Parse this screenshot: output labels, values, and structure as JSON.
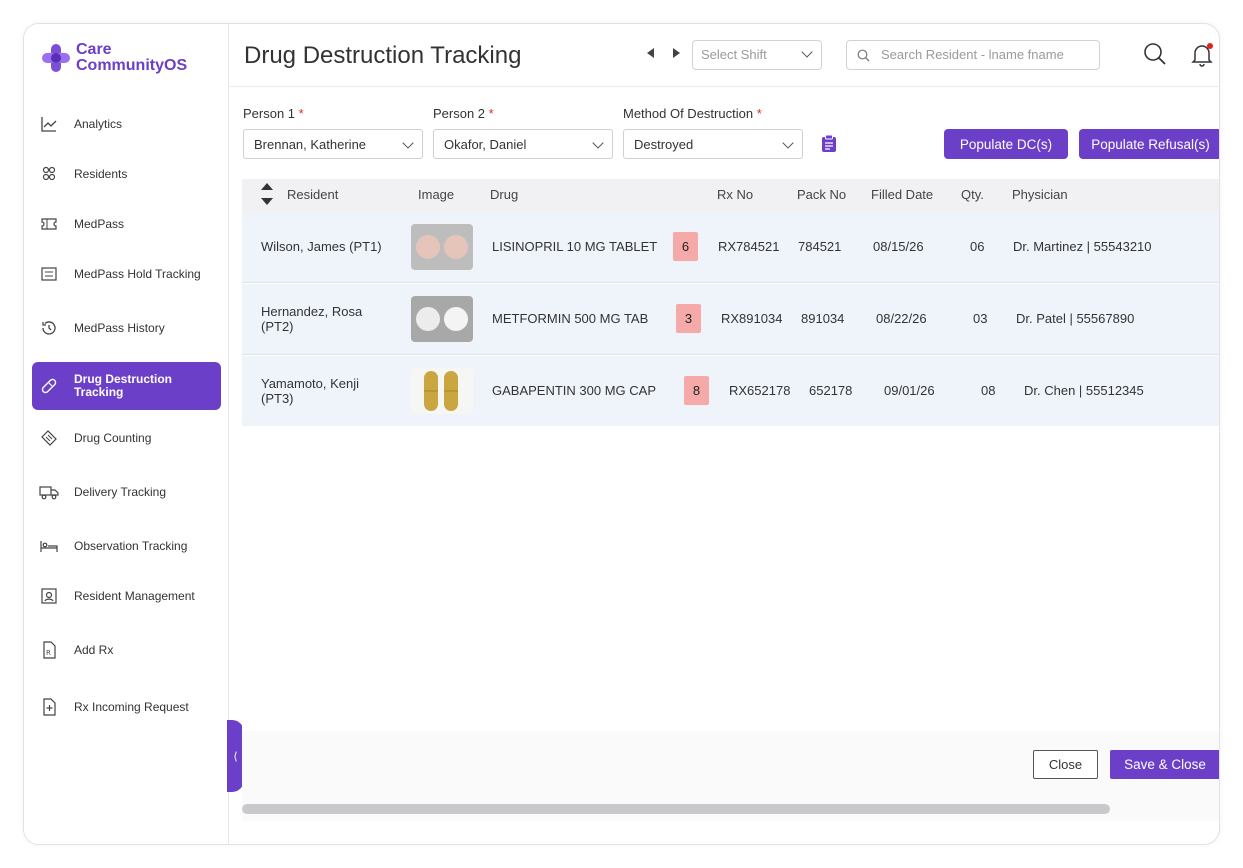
{
  "app": {
    "logo_line1": "Care",
    "logo_line2": "CommunityOS",
    "brand_color": "#6b3fc8"
  },
  "sidebar": {
    "items": [
      {
        "label": "Analytics",
        "icon": "chart-line-icon"
      },
      {
        "label": "Residents",
        "icon": "people-icon"
      },
      {
        "label": "MedPass",
        "icon": "ticket-icon"
      },
      {
        "label": "MedPass Hold Tracking",
        "icon": "hold-list-icon"
      },
      {
        "label": "MedPass History",
        "icon": "history-icon"
      },
      {
        "label": "Drug Destruction Tracking",
        "icon": "pill-icon",
        "active": true
      },
      {
        "label": "Drug Counting",
        "icon": "tag-icon"
      },
      {
        "label": "Delivery Tracking",
        "icon": "truck-icon"
      },
      {
        "label": "Observation Tracking",
        "icon": "bed-icon"
      },
      {
        "label": "Resident Management",
        "icon": "id-card-icon"
      },
      {
        "label": "Add Rx",
        "icon": "rx-file-icon"
      },
      {
        "label": "Rx Incoming Request",
        "icon": "file-plus-icon"
      }
    ],
    "collapse_glyph": "⟨"
  },
  "header": {
    "title": "Drug Destruction Tracking",
    "shift_placeholder": "Select Shift",
    "search_placeholder": "Search Resident - lname fname"
  },
  "filters": {
    "person1_label": "Person 1",
    "person1_value": "Brennan, Katherine",
    "person2_label": "Person 2",
    "person2_value": "Okafor, Daniel",
    "method_label": "Method Of Destruction",
    "method_value": "Destroyed",
    "required_mark": "*",
    "populate_dc_label": "Populate DC(s)",
    "populate_refusal_label": "Populate Refusal(s)"
  },
  "table": {
    "columns": [
      "Resident",
      "Image",
      "Drug",
      "Rx No",
      "Pack No",
      "Filled Date",
      "Qty.",
      "Physician"
    ],
    "rows": [
      {
        "resident": "Wilson, James (PT1)",
        "drug": "LISINOPRIL 10 MG TABLET",
        "badge": "6",
        "rx_no": "RX784521",
        "pack_no": "784521",
        "filled_date": "08/15/26",
        "qty": "06",
        "physician": "Dr. Martinez | 55543210",
        "pill": "pink-round-tablets"
      },
      {
        "resident": "Hernandez, Rosa (PT2)",
        "drug": "METFORMIN 500 MG TAB",
        "badge": "3",
        "rx_no": "RX891034",
        "pack_no": "891034",
        "filled_date": "08/22/26",
        "qty": "03",
        "physician": "Dr. Patel | 55567890",
        "pill": "white-round-tablets"
      },
      {
        "resident": "Yamamoto, Kenji (PT3)",
        "drug": "GABAPENTIN 300 MG CAP",
        "badge": "8",
        "rx_no": "RX652178",
        "pack_no": "652178",
        "filled_date": "09/01/26",
        "qty": "08",
        "physician": "Dr. Chen | 55512345",
        "pill": "yellow-capsules"
      }
    ]
  },
  "footer": {
    "close_label": "Close",
    "save_label": "Save & Close"
  }
}
